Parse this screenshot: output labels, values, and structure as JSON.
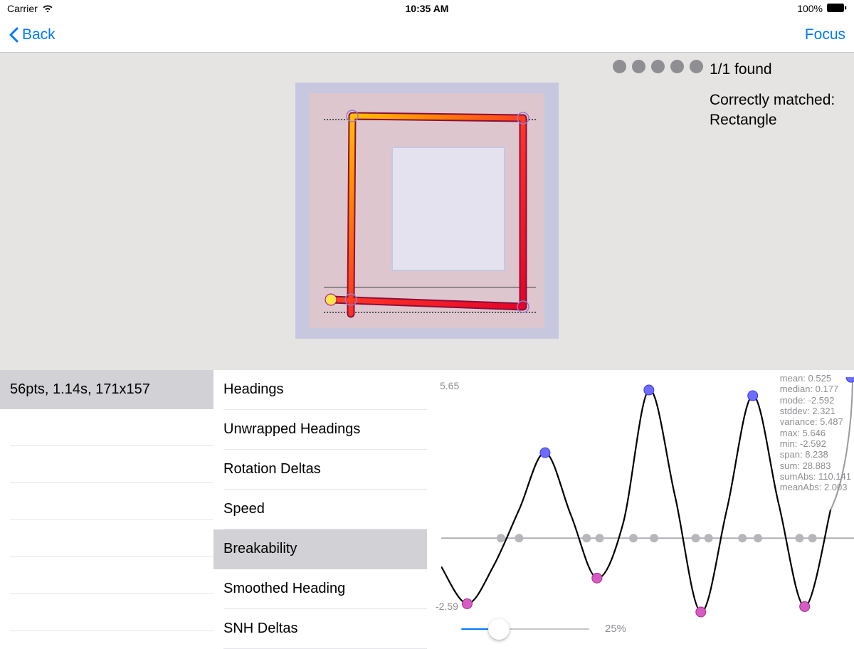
{
  "status": {
    "carrier": "Carrier",
    "time": "10:35 AM",
    "battery": "100%"
  },
  "nav": {
    "back": "Back",
    "focus": "Focus"
  },
  "result": {
    "found": "1/1 found",
    "match_label": "Correctly matched:",
    "match_value": "Rectangle",
    "indicator_count": 5
  },
  "drawing": {
    "stroke_points": "56pts",
    "duration": "1.14s",
    "size": "171x157",
    "summary": "56pts, 1.14s, 171x157"
  },
  "metrics": {
    "items": [
      {
        "label": "Headings",
        "selected": false
      },
      {
        "label": "Unwrapped Headings",
        "selected": false
      },
      {
        "label": "Rotation Deltas",
        "selected": false
      },
      {
        "label": "Speed",
        "selected": false
      },
      {
        "label": "Breakability",
        "selected": true
      },
      {
        "label": "Smoothed Heading",
        "selected": false
      },
      {
        "label": "SNH Deltas",
        "selected": false
      }
    ]
  },
  "chart_data": {
    "type": "line",
    "title": "",
    "xlabel": "",
    "ylabel": "",
    "ylim": [
      -2.59,
      5.65
    ],
    "y_axis_labels": {
      "high": "5.65",
      "low": "-2.59"
    },
    "x": [
      0,
      1,
      2,
      3,
      4,
      5,
      6,
      7,
      8,
      9,
      10,
      11,
      12,
      13,
      14,
      15
    ],
    "values": [
      -1.0,
      -2.3,
      -1.0,
      1.0,
      3.0,
      0.8,
      -1.4,
      0.5,
      5.2,
      1.5,
      -2.59,
      1.0,
      5.0,
      1.2,
      -2.4,
      1.0
    ],
    "zero_crossings_x": [
      2.3,
      3.0,
      5.6,
      6.1,
      7.4,
      8.2,
      9.8,
      10.3,
      11.6,
      12.2,
      13.8,
      14.3
    ],
    "maxima": [
      {
        "x": 8,
        "y": 5.2
      },
      {
        "x": 12,
        "y": 5.0
      },
      {
        "x": 4,
        "y": 3.0
      },
      {
        "x": 15.9,
        "y": 5.646
      }
    ],
    "minima": [
      {
        "x": 1,
        "y": -2.3
      },
      {
        "x": 6,
        "y": -1.4
      },
      {
        "x": 10,
        "y": -2.59
      },
      {
        "x": 14,
        "y": -2.4
      }
    ]
  },
  "stats": {
    "mean": "0.525",
    "median": "0.177",
    "mode": "-2.592",
    "stddev": "2.321",
    "variance": "5.487",
    "max": "5.646",
    "min": "-2.592",
    "span": "8.238",
    "sum": "28.883",
    "sumAbs": "110.141",
    "meanAbs": "2.003"
  },
  "slider": {
    "value": 25,
    "label": "25%"
  },
  "icons": {
    "carrier_wifi": "wifi-icon",
    "battery": "battery-icon",
    "back_chevron": "chevron-left-icon"
  }
}
